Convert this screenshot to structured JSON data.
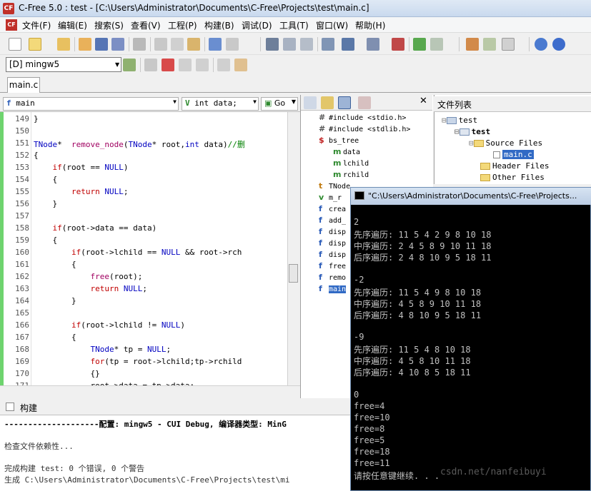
{
  "window": {
    "title": "C-Free 5.0 : test - [C:\\Users\\Administrator\\Documents\\C-Free\\Projects\\test\\main.c]"
  },
  "menu": [
    "文件(F)",
    "编辑(E)",
    "搜索(S)",
    "查看(V)",
    "工程(P)",
    "构建(B)",
    "调试(D)",
    "工具(T)",
    "窗口(W)",
    "帮助(H)"
  ],
  "compiler_select": "[D] mingw5",
  "editor_tab": "main.c",
  "editor_tools": {
    "function": "main",
    "member": "int data;",
    "go_label": "Go"
  },
  "code": {
    "line_numbers": [
      "149",
      "150",
      "151",
      "152",
      "153",
      "154",
      "155",
      "156",
      "157",
      "158",
      "159",
      "160",
      "161",
      "162",
      "163",
      "164",
      "165",
      "166",
      "167",
      "168",
      "169",
      "170",
      "171"
    ],
    "lines": [
      "}",
      "",
      "TNode*  remove_node(TNode* root,int data)//删",
      "{",
      "    if(root == NULL)",
      "    {",
      "        return NULL;",
      "    }",
      "",
      "    if(root->data == data)",
      "    {",
      "        if(root->lchild == NULL && root->rch",
      "        {",
      "            free(root);",
      "            return NULL;",
      "        }",
      "",
      "        if(root->lchild != NULL)",
      "        {",
      "            TNode* tp = NULL;",
      "            for(tp = root->lchild;tp->rchild",
      "            {}",
      "            root->data = tp->data;"
    ]
  },
  "class_view": {
    "items": [
      {
        "icon": "#",
        "label": "#include <stdio.h>"
      },
      {
        "icon": "#",
        "label": "#include <stdlib.h>"
      },
      {
        "icon": "$",
        "label": "bs_tree"
      },
      {
        "icon": "m",
        "label": "data"
      },
      {
        "icon": "m",
        "label": "lchild"
      },
      {
        "icon": "m",
        "label": "rchild"
      },
      {
        "icon": "t",
        "label": "TNode"
      },
      {
        "icon": "v",
        "label": "m_r"
      },
      {
        "icon": "f",
        "label": "crea"
      },
      {
        "icon": "f",
        "label": "add_"
      },
      {
        "icon": "f",
        "label": "disp"
      },
      {
        "icon": "f",
        "label": "disp"
      },
      {
        "icon": "f",
        "label": "disp"
      },
      {
        "icon": "f",
        "label": "free"
      },
      {
        "icon": "f",
        "label": "remo"
      },
      {
        "icon": "f",
        "label": "main"
      }
    ]
  },
  "file_list": {
    "title": "文件列表",
    "items": [
      "test",
      "test",
      "Source Files",
      "main.c",
      "Header Files",
      "Other Files"
    ]
  },
  "build": {
    "title": "构建",
    "lines": [
      "--------------------配置: mingw5 - CUI Debug, 编译器类型: MinG",
      "",
      "检查文件依赖性...",
      "",
      "完成构建 test: 0 个错误, 0 个警告",
      "生成 C:\\Users\\Administrator\\Documents\\C-Free\\Projects\\test\\mi"
    ]
  },
  "console": {
    "title": "\"C:\\Users\\Administrator\\Documents\\C-Free\\Projects...",
    "lines": [
      "2",
      "先序遍历: 11 5 4 2 9 8 10 18",
      "中序遍历: 2 4 5 8 9 10 11 18",
      "后序遍历: 2 4 8 10 9 5 18 11",
      "",
      "-2",
      "先序遍历: 11 5 4 9 8 10 18",
      "中序遍历: 4 5 8 9 10 11 18",
      "后序遍历: 4 8 10 9 5 18 11",
      "",
      "-9",
      "先序遍历: 11 5 4 8 10 18",
      "中序遍历: 4 5 8 10 11 18",
      "后序遍历: 4 10 8 5 18 11",
      "",
      "0",
      "free=4",
      "free=10",
      "free=8",
      "free=5",
      "free=18",
      "free=11",
      "请按任意键继续. . ."
    ]
  },
  "watermark": "csdn.net/nanfeibuyi"
}
